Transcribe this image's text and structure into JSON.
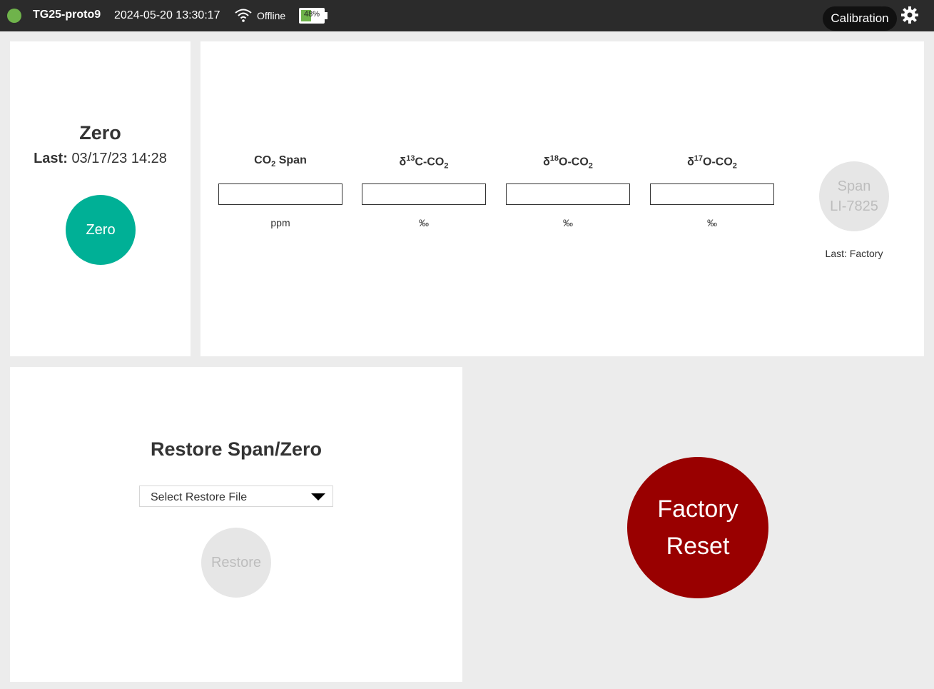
{
  "topbar": {
    "device_name": "TG25-proto9",
    "datetime": "2024-05-20 13:30:17",
    "network_status": "Offline",
    "battery_percent": 48,
    "battery_label": "48%",
    "nav_label": "Calibration",
    "status_color": "#6fb34b",
    "icons": [
      "wifi-icon",
      "battery-icon",
      "home-icon",
      "gear-icon"
    ]
  },
  "zero": {
    "title": "Zero",
    "last_label": "Last:",
    "last_value": "03/17/23 14:28",
    "button_label": "Zero",
    "button_color": "#00b096"
  },
  "span": {
    "fields": [
      {
        "label_html": "CO<sub>2</sub> Span",
        "value": "",
        "unit": "ppm"
      },
      {
        "label_html": "δ<sup>13</sup>C-CO<sub>2</sub>",
        "value": "",
        "unit": "‰"
      },
      {
        "label_html": "δ<sup>18</sup>O-CO<sub>2</sub>",
        "value": "",
        "unit": "‰"
      },
      {
        "label_html": "δ<sup>17</sup>O-CO<sub>2</sub>",
        "value": "",
        "unit": "‰"
      }
    ],
    "button_line1": "Span",
    "button_line2": "LI-7825",
    "last": "Last: Factory"
  },
  "restore": {
    "title": "Restore Span/Zero",
    "select_placeholder": "Select Restore File",
    "button_label": "Restore"
  },
  "factory_reset": {
    "line1": "Factory",
    "line2": "Reset",
    "color": "#990000"
  }
}
